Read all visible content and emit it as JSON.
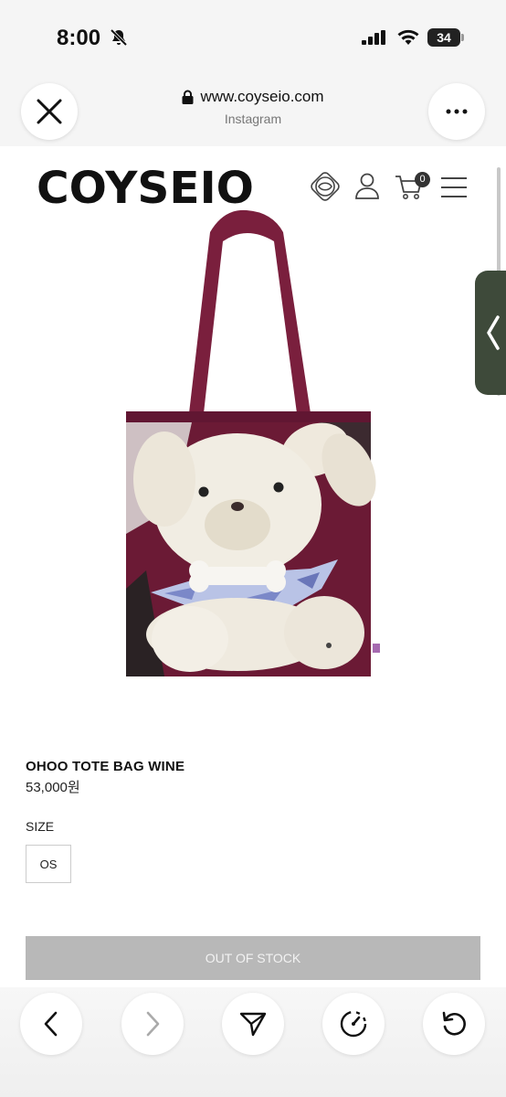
{
  "status_bar": {
    "time": "8:00",
    "battery": "34",
    "icons": [
      "bell-slash-icon",
      "signal-icon",
      "wifi-icon",
      "battery-icon"
    ]
  },
  "browser": {
    "url": "www.coyseio.com",
    "source": "Instagram",
    "icons": [
      "close-icon",
      "lock-icon",
      "more-icon"
    ]
  },
  "site": {
    "logo_text": "COYSEIO",
    "cart_count": "0",
    "icons": [
      "brand-symbol-icon",
      "user-icon",
      "cart-icon",
      "menu-icon"
    ]
  },
  "product": {
    "name": "OHOO TOTE BAG WINE",
    "price": "53,000원",
    "size_label": "SIZE",
    "size_options": [
      "OS"
    ],
    "stock_button": "OUT OF STOCK",
    "colors": {
      "bag": "#6b1a35",
      "strap": "#7a1f3d",
      "disabled_button": "#b8b8b8"
    }
  },
  "toolbar": {
    "icons": [
      "chevron-left-icon",
      "chevron-right-icon",
      "share-icon",
      "speedometer-icon",
      "reload-icon"
    ]
  }
}
